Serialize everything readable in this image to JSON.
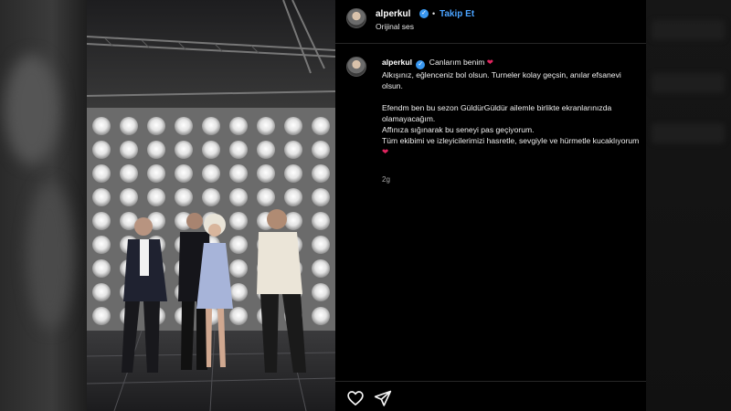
{
  "post": {
    "username": "alperkul",
    "separator": "•",
    "follow_label": "Takip Et",
    "audio_label": "Orijinal ses"
  },
  "caption": {
    "username": "alperkul",
    "first_line": "Canlarım benim",
    "line_1": "Alkışınız, eğlenceniz bol olsun. Turneler kolay geçsin, anılar efsanevi olsun.",
    "line_2": "Efendm ben bu sezon GüldürGüldür ailemle birlikte ekranlarınızda olamayacağım.",
    "line_3": "Affınıza sığınarak bu seneyi pas geçiyorum.",
    "line_4": "Tüm ekibimi ve izleyicilerimizi hasretle, sevgiyle ve hürmetle kucaklıyorum",
    "heart_glyph": "❤"
  },
  "timestamp": "2g",
  "colors": {
    "accent_blue": "#4aa3ff",
    "verified_badge": "#3897f0",
    "heart": "#e0245e",
    "panel_bg": "#000000"
  },
  "icons": [
    "heart-outline-icon",
    "share-send-icon",
    "verified-badge-icon"
  ]
}
